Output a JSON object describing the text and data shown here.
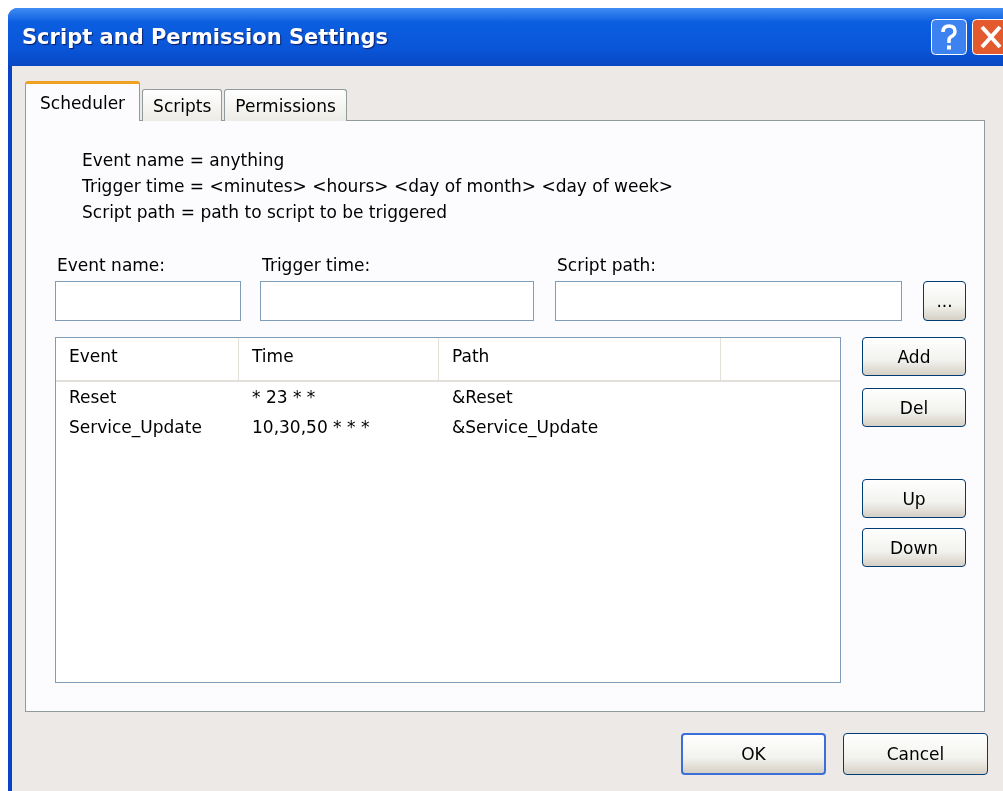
{
  "window": {
    "title": "Script and Permission Settings"
  },
  "tabs": [
    {
      "label": "Scheduler",
      "selected": true
    },
    {
      "label": "Scripts",
      "selected": false
    },
    {
      "label": "Permissions",
      "selected": false
    }
  ],
  "description": [
    "Event name = anything",
    "Trigger time = <minutes> <hours> <day of month> <day of week>",
    "Script path = path to script to be triggered"
  ],
  "fields": [
    {
      "label": "Event name:"
    },
    {
      "label": "Trigger time:"
    },
    {
      "label": "Script path:"
    }
  ],
  "browse_button": "...",
  "table": {
    "columns": [
      "Event",
      "Time",
      "Path"
    ],
    "rows": [
      [
        "Reset",
        "* 23 * *",
        "&Reset"
      ],
      [
        "Service_Update",
        "10,30,50 * * *",
        "&Service_Update"
      ]
    ]
  },
  "side_buttons": [
    "Add",
    "Del",
    "Up",
    "Down"
  ],
  "dialog_buttons": [
    {
      "label": "OK",
      "default": true
    },
    {
      "label": "Cancel",
      "default": false
    }
  ]
}
